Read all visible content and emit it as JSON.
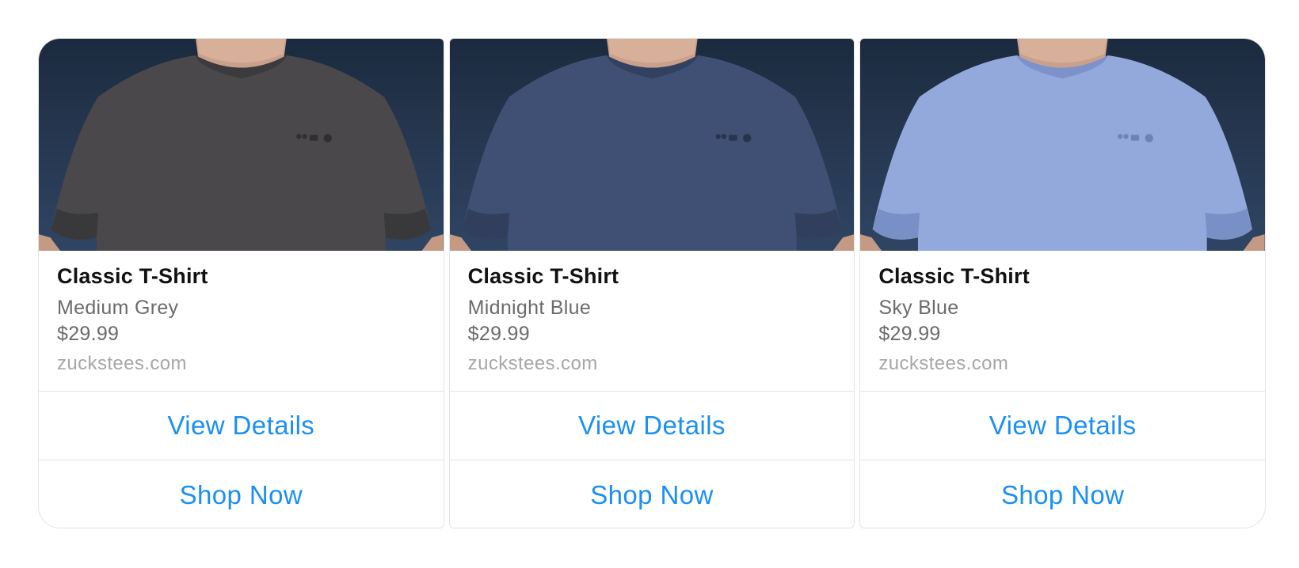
{
  "colors": {
    "link": "#1a8ff4",
    "title": "#111111",
    "secondary": "#6b6b6b",
    "muted": "#a6a6a6",
    "border": "#e4e4e4"
  },
  "cards": [
    {
      "image_alt": "t-shirt-photo",
      "shirt_color": "#4a484a",
      "shirt_shade": "#353436",
      "title": "Classic T-Shirt",
      "subtitle": "Medium Grey",
      "price": "$29.99",
      "domain": "zuckstees.com",
      "view_details_label": "View Details",
      "shop_now_label": "Shop Now"
    },
    {
      "image_alt": "t-shirt-photo",
      "shirt_color": "#3f5074",
      "shirt_shade": "#2e3b58",
      "title": "Classic T-Shirt",
      "subtitle": "Midnight Blue",
      "price": "$29.99",
      "domain": "zuckstees.com",
      "view_details_label": "View Details",
      "shop_now_label": "Shop Now"
    },
    {
      "image_alt": "t-shirt-photo",
      "shirt_color": "#93a9dc",
      "shirt_shade": "#7389c2",
      "title": "Classic T-Shirt",
      "subtitle": "Sky Blue",
      "price": "$29.99",
      "domain": "zuckstees.com",
      "view_details_label": "View Details",
      "shop_now_label": "Shop Now"
    }
  ]
}
